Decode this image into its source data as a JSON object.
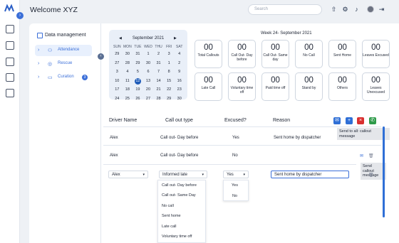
{
  "app": {
    "title": "Welcome XYZ"
  },
  "header": {
    "search_placeholder": "Search",
    "icons": [
      "upload-icon",
      "gear-icon",
      "bell-icon",
      "avatar",
      "logout-icon"
    ]
  },
  "rail": {
    "icons": [
      "dashboard-icon",
      "message-icon",
      "search-doc-icon",
      "payment-icon",
      "document-icon"
    ]
  },
  "sidebar": {
    "title": "Data management",
    "items": [
      {
        "label": "Attendance",
        "icon": "users-icon",
        "active": true
      },
      {
        "label": "Rescue",
        "icon": "lifebuoy-icon",
        "active": false
      },
      {
        "label": "Curation",
        "icon": "folder-icon",
        "active": false,
        "badge": "3"
      }
    ]
  },
  "calendar": {
    "month": "September 2021",
    "dow": [
      "SUN",
      "MON",
      "TUE",
      "WED",
      "THU",
      "FRI",
      "SAT"
    ],
    "days": [
      "29",
      "30",
      "31",
      "1",
      "2",
      "3",
      "4",
      "27",
      "28",
      "29",
      "30",
      "31",
      "1",
      "2",
      "3",
      "4",
      "5",
      "6",
      "7",
      "8",
      "9",
      "10",
      "11",
      "12",
      "13",
      "14",
      "15",
      "16",
      "17",
      "18",
      "19",
      "20",
      "21",
      "22",
      "23",
      "24",
      "25",
      "26",
      "27",
      "28",
      "29",
      "30"
    ],
    "selected_index": 23
  },
  "week": {
    "title": "Week 24- September 2021",
    "stats": [
      {
        "num": "00",
        "label": "Total Callouts"
      },
      {
        "num": "00",
        "label": "Call Out- Day before"
      },
      {
        "num": "00",
        "label": "Call Out- Same day"
      },
      {
        "num": "00",
        "label": "No Call"
      },
      {
        "num": "00",
        "label": "Sent Home"
      },
      {
        "num": "00",
        "label": "Leaves Excused"
      },
      {
        "num": "00",
        "label": "Late Call"
      },
      {
        "num": "00",
        "label": "Voluntary time off"
      },
      {
        "num": "00",
        "label": "Paid time off"
      },
      {
        "num": "00",
        "label": "Stand by"
      },
      {
        "num": "00",
        "label": "Others"
      },
      {
        "num": "00",
        "label": "Leaves Unexcused"
      }
    ]
  },
  "table": {
    "headers": {
      "driver": "Driver Name",
      "callout": "Call out type",
      "excused": "Excused?",
      "reason": "Reason"
    },
    "rows": [
      {
        "driver": "Alex",
        "callout": "Call out- Day before",
        "excused": "Yes",
        "reason": "Sent home by dispatcher"
      },
      {
        "driver": "Alex",
        "callout": "Call out- Day before",
        "excused": "No",
        "reason": ""
      }
    ],
    "edit_row": {
      "driver": "Alex",
      "callout": "Informed late",
      "excused": "Yes",
      "reason": "Sent home by dispatcher"
    },
    "tooltips": {
      "send_all": "Send to all: callout message",
      "send_one_line1": "Send callout",
      "send_one_line2": "message"
    }
  },
  "callout_options": [
    "Call out- Day before",
    "Call out- Same Day",
    "No call",
    "Sent home",
    "Late call",
    "Voluntary time off"
  ],
  "excused_options": [
    "Yes",
    "No"
  ],
  "colors": {
    "accent": "#3b6fd8",
    "red": "#d93030",
    "green": "#2e9b4a"
  }
}
